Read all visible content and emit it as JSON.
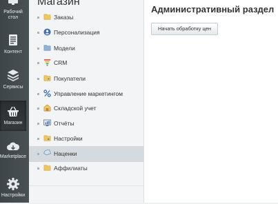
{
  "rail": {
    "items": [
      {
        "label_line1": "Рабочий",
        "label_line2": "стол",
        "icon": "desktop-icon"
      },
      {
        "label": "Контент",
        "icon": "document-icon"
      },
      {
        "label": "Сервисы",
        "icon": "layers-icon"
      },
      {
        "label": "Магазин",
        "icon": "basket-icon"
      },
      {
        "label": "Marketplace",
        "icon": "cloud-download-icon"
      },
      {
        "label": "Настройки",
        "icon": "gear-icon"
      }
    ]
  },
  "menu": {
    "title": "Магазин",
    "items": [
      {
        "label": "Заказы",
        "icon": "folder-cart-icon"
      },
      {
        "label": "Персонализация",
        "icon": "user-circle-icon"
      },
      {
        "label": "Модели",
        "icon": "folder-icon"
      },
      {
        "label": "CRM",
        "icon": "funnel-icon"
      },
      {
        "label": "Покупатели",
        "icon": "folder-people-icon"
      },
      {
        "label": "Управление маркетингом",
        "icon": "percent-icon"
      },
      {
        "label": "Складской учет",
        "icon": "warehouse-icon"
      },
      {
        "label": "Отчёты",
        "icon": "monitor-chart-icon"
      },
      {
        "label": "Настройки",
        "icon": "folder-settings-icon"
      },
      {
        "label": "Наценки",
        "icon": "price-tag-icon",
        "active": true
      },
      {
        "label": "Аффилиаты",
        "icon": "folder-affiliate-icon"
      }
    ]
  },
  "main": {
    "title": "Административный раздел",
    "button_label": "Начать обработку цен"
  },
  "colors": {
    "rail_bg": "#454c50",
    "menu_bg": "#f2f4f5",
    "active_item_bg": "#d4dade",
    "folder_yellow": "#f0c75a"
  }
}
